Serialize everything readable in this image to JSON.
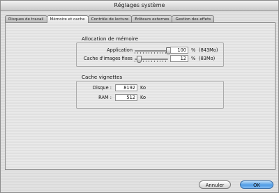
{
  "window": {
    "title": "Réglages système"
  },
  "tabs": [
    {
      "label": "Disques de travail",
      "active": false
    },
    {
      "label": "Mémoire et cache",
      "active": true
    },
    {
      "label": "Contrôle de lecture",
      "active": false
    },
    {
      "label": "Éditeurs externes",
      "active": false
    },
    {
      "label": "Gestion des effets",
      "active": false
    }
  ],
  "memory": {
    "title": "Allocation de mémoire",
    "application": {
      "label": "Application",
      "value": "100",
      "unit": "%",
      "extra": "(843Mo)",
      "level": 1.0
    },
    "still_cache": {
      "label": "Cache d'images fixes",
      "value": "12",
      "unit": "%",
      "extra": "(83Mo)",
      "level": 0.12
    }
  },
  "thumbnail_cache": {
    "title": "Cache vignettes",
    "disk": {
      "label": "Disque :",
      "value": "8192",
      "unit": "Ko"
    },
    "ram": {
      "label": "RAM :",
      "value": "512",
      "unit": "Ko"
    }
  },
  "buttons": {
    "cancel": "Annuler",
    "ok": "OK"
  },
  "colors": {
    "default_button": "#4f9be5"
  }
}
